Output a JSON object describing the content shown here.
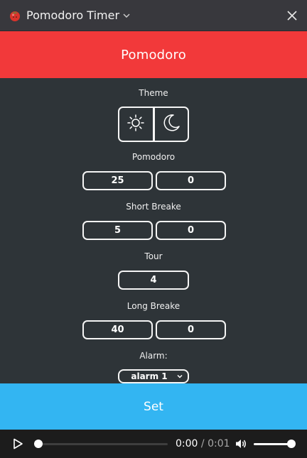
{
  "window": {
    "title": "Pomodoro Timer",
    "app_icon": "tomato-icon",
    "close_icon": "close-icon"
  },
  "header": {
    "title": "Pomodoro",
    "color": "#f2393a"
  },
  "theme": {
    "label": "Theme",
    "options": [
      {
        "icon": "sun-icon"
      },
      {
        "icon": "moon-icon"
      }
    ]
  },
  "pomodoro": {
    "label": "Pomodoro",
    "minutes": "25",
    "seconds": "0"
  },
  "short_break": {
    "label": "Short Breake",
    "minutes": "5",
    "seconds": "0"
  },
  "tour": {
    "label": "Tour",
    "value": "4"
  },
  "long_break": {
    "label": "Long Breake",
    "minutes": "40",
    "seconds": "0"
  },
  "alarm": {
    "label": "Alarm:",
    "selected": "alarm 1"
  },
  "set_button": {
    "label": "Set",
    "color": "#33b5f2"
  },
  "player": {
    "current_time": "0:00",
    "separator": " / ",
    "duration": "0:01",
    "progress": 0.0,
    "volume": 1.0
  }
}
